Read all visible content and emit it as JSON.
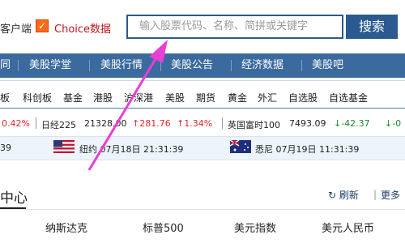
{
  "header": {
    "client_text": "客户端",
    "choice_check": "✓",
    "choice_label": "Choice数据",
    "search_placeholder": "输入股票代码、名称、简拼或关键字",
    "search_button": "搜索"
  },
  "main_nav": {
    "items": [
      "同",
      "美股学堂",
      "美股行情",
      "美股公告",
      "经济数据",
      "美股吧"
    ]
  },
  "sub_nav": {
    "items": [
      "板",
      "科创板",
      "基金",
      "港股",
      "沪深港",
      "美股",
      "期货",
      "黄金",
      "外汇",
      "自选股",
      "自选基金"
    ]
  },
  "ticker": {
    "first_pct": "0.42%",
    "nikkei_name": "日经225",
    "nikkei_value": "21328.00",
    "nikkei_change": "↑281.76",
    "nikkei_pct": "↑1.34%",
    "ftse_name": "英国富时100",
    "ftse_value": "7493.09",
    "ftse_change": "↓-42.37",
    "ftse_pct_partial": "↓-0"
  },
  "times": {
    "first": "39",
    "newyork": "纽约 07月18日 21:31:39",
    "sydney": "悉尼 07月19日 11:31:39"
  },
  "center": {
    "title": "中心",
    "refresh_icon": "↻",
    "refresh_label": "刷新",
    "more_label": "更多"
  },
  "index_tabs": [
    "纳斯达克",
    "标普500",
    "美元指数",
    "美元人民币"
  ],
  "colors": {
    "nav_bg": "#3a6a9e",
    "search_border": "#2a5a8f",
    "up": "#e0262b",
    "down": "#1d8a2c",
    "arrow": "#e83fd6"
  }
}
